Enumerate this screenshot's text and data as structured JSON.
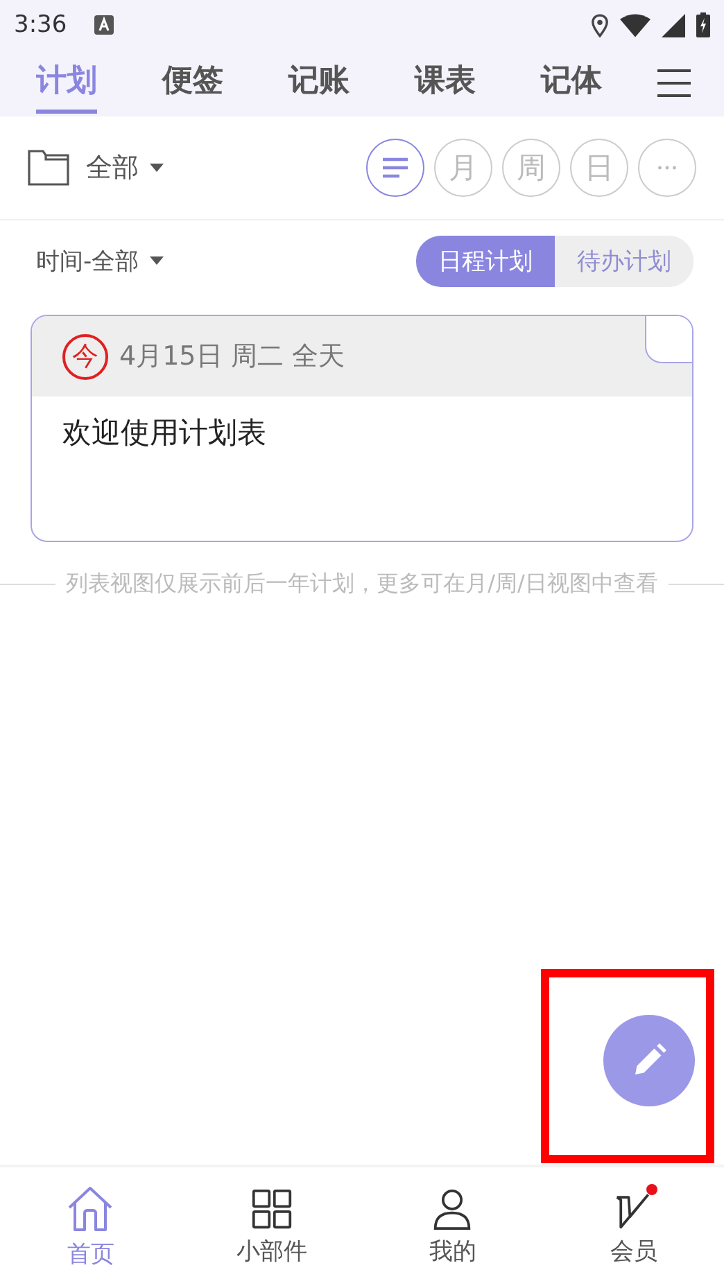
{
  "status_bar": {
    "time": "3:36"
  },
  "tabs": [
    {
      "label": "计划",
      "selected": true
    },
    {
      "label": "便签",
      "selected": false
    },
    {
      "label": "记账",
      "selected": false
    },
    {
      "label": "课表",
      "selected": false
    },
    {
      "label": "记体",
      "selected": false
    }
  ],
  "folder": {
    "label": "全部"
  },
  "view_modes": [
    {
      "kind": "list",
      "selected": true
    },
    {
      "kind": "text",
      "label": "月",
      "selected": false
    },
    {
      "kind": "text",
      "label": "周",
      "selected": false
    },
    {
      "kind": "text",
      "label": "日",
      "selected": false
    },
    {
      "kind": "more",
      "selected": false
    }
  ],
  "time_filter": {
    "label": "时间-全部"
  },
  "plan_types": [
    {
      "label": "日程计划",
      "selected": true
    },
    {
      "label": "待办计划",
      "selected": false
    }
  ],
  "plans": [
    {
      "badge": "今",
      "date": "4月15日 周二 全天",
      "title": "欢迎使用计划表"
    }
  ],
  "list_note": "列表视图仅展示前后一年计划，更多可在月/周/日视图中查看",
  "fab": {
    "highlighted": true
  },
  "bottom_nav": [
    {
      "kind": "home",
      "label": "首页",
      "selected": true,
      "badge": false
    },
    {
      "kind": "widgets",
      "label": "小部件",
      "selected": false,
      "badge": false
    },
    {
      "kind": "profile",
      "label": "我的",
      "selected": false,
      "badge": false
    },
    {
      "kind": "vip",
      "label": "会员",
      "selected": false,
      "badge": true
    }
  ]
}
